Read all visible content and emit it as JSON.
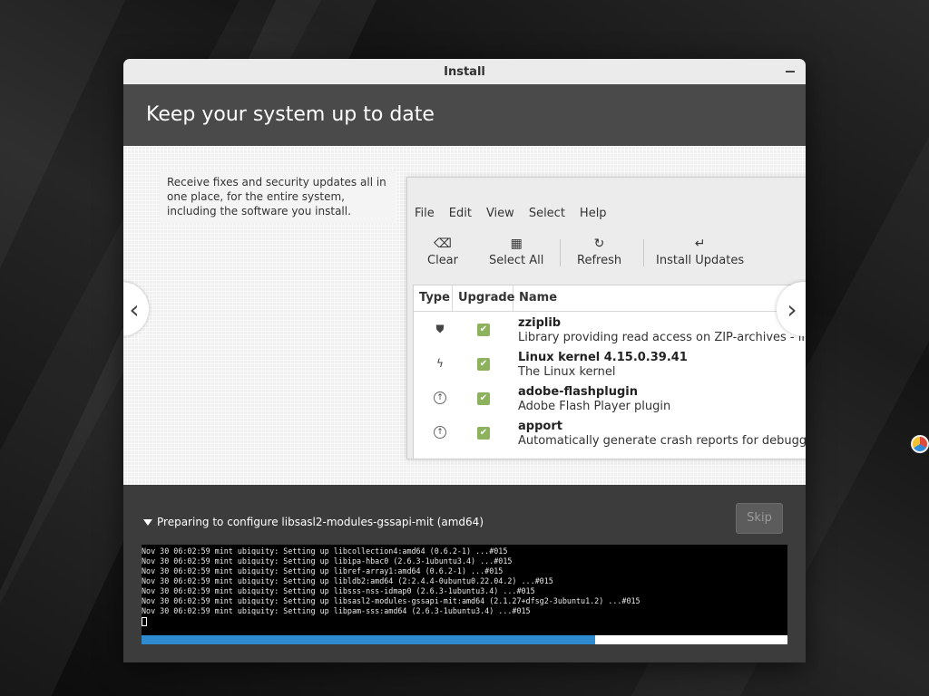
{
  "window": {
    "title": "Install"
  },
  "header": {
    "title": "Keep your system up to date"
  },
  "slide": {
    "description": "Receive fixes and security updates all in one place, for the entire system, including the software you install.",
    "app": {
      "menu": [
        "File",
        "Edit",
        "View",
        "Select",
        "Help"
      ],
      "toolbar": {
        "clear": "Clear",
        "select_all": "Select All",
        "refresh": "Refresh",
        "install_updates": "Install Updates"
      },
      "columns": {
        "type": "Type",
        "upgrade": "Upgrade",
        "name": "Name"
      },
      "rows": [
        {
          "name": "zziplib",
          "description": "Library providing read access on ZIP-archives - library",
          "type_icon": "shield-icon",
          "upgrade": true
        },
        {
          "name": "Linux kernel 4.15.0.39.41",
          "description": "The Linux kernel",
          "type_icon": "lightning-icon",
          "upgrade": true
        },
        {
          "name": "adobe-flashplugin",
          "description": "Adobe Flash Player plugin",
          "type_icon": "arrow-up-circle-icon",
          "upgrade": true
        },
        {
          "name": "apport",
          "description": "Automatically generate crash reports for debugging",
          "type_icon": "arrow-up-circle-icon",
          "upgrade": true
        }
      ]
    }
  },
  "install": {
    "status": "Preparing to configure libsasl2-modules-gssapi-mit (amd64)",
    "skip_label": "Skip",
    "progress": 0.702,
    "log": [
      "Nov 30 06:02:59 mint ubiquity: Setting up libcollection4:amd64 (0.6.2-1) ...#015",
      "Nov 30 06:02:59 mint ubiquity: Setting up libipa-hbac0 (2.6.3-1ubuntu3.4) ...#015",
      "Nov 30 06:02:59 mint ubiquity: Setting up libref-array1:amd64 (0.6.2-1) ...#015",
      "Nov 30 06:02:59 mint ubiquity: Setting up libldb2:amd64 (2:2.4.4-0ubuntu0.22.04.2) ...#015",
      "Nov 30 06:02:59 mint ubiquity: Setting up libsss-nss-idmap0 (2.6.3-1ubuntu3.4) ...#015",
      "Nov 30 06:02:59 mint ubiquity: Setting up libsasl2-modules-gssapi-mit:amd64 (2.1.27+dfsg2-3ubuntu1.2) ...#015",
      "Nov 30 06:02:59 mint ubiquity: Setting up libpam-sss:amd64 (2.6.3-1ubuntu3.4) ...#015"
    ]
  }
}
